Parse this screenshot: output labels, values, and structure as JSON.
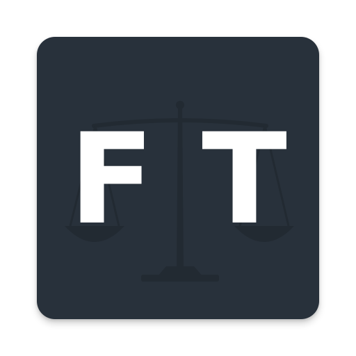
{
  "icon": {
    "monogram": {
      "left_letter": "F",
      "right_letter": "T"
    },
    "background_color": "#28313b",
    "letter_color": "#ffffff",
    "emblem": "scales-of-justice-icon"
  }
}
